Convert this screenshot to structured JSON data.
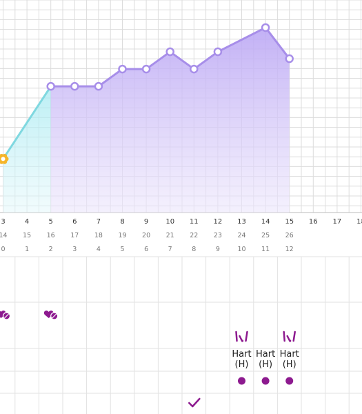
{
  "colors": {
    "purple": "#b8a4f2",
    "purple_stroke": "#a78ee9",
    "teal": "#7fd8e0",
    "teal_fill": "#d6f6fa",
    "grid": "#dcdcdc",
    "marker_purple": "#8d1a8f",
    "highlight_marker": "#f5b52a"
  },
  "chart_data": {
    "type": "area",
    "x": [
      3,
      4,
      5,
      6,
      7,
      8,
      9,
      10,
      11,
      12,
      13,
      14,
      15
    ],
    "series": [
      {
        "values": [
          null,
          null,
          64,
          64,
          64,
          69,
          69,
          74,
          69,
          74,
          null,
          81,
          72
        ]
      }
    ],
    "transition_values": [
      {
        "x": 3,
        "y": 43
      },
      {
        "x": 5,
        "y": 64
      }
    ],
    "highlighted_point": {
      "x": 3,
      "y": 43
    }
  },
  "axis": {
    "row1": [
      "3",
      "4",
      "5",
      "6",
      "7",
      "8",
      "9",
      "10",
      "11",
      "12",
      "13",
      "14",
      "15",
      "16",
      "17",
      "18"
    ],
    "row2": [
      "14",
      "15",
      "16",
      "17",
      "18",
      "19",
      "20",
      "21",
      "22",
      "23",
      "24",
      "25",
      "26"
    ],
    "row3": [
      "0",
      "1",
      "2",
      "3",
      "4",
      "5",
      "6",
      "7",
      "8",
      "9",
      "10",
      "11",
      "12"
    ]
  },
  "events": {
    "heart_icons": [
      3,
      5
    ],
    "kick_icons": [
      13,
      15
    ],
    "hart_labels": [
      {
        "x": 13,
        "line1": "Hart",
        "line2": "(H)"
      },
      {
        "x": 14,
        "line1": "Hart",
        "line2": "(H)"
      },
      {
        "x": 15,
        "line1": "Hart",
        "line2": "(H)"
      }
    ],
    "dots": [
      13,
      14,
      15
    ],
    "check_at": 11,
    "icon_names": {
      "heart": "heart-pill-icon",
      "kick": "kick-icon",
      "dot": "dot-marker",
      "check": "checkmark-icon"
    }
  }
}
